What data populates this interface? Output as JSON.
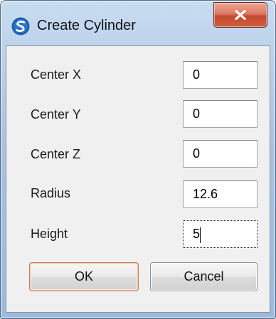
{
  "window": {
    "title": "Create Cylinder",
    "app_icon": "app-logo-icon",
    "close_icon": "close-icon",
    "close_symbol": "✕"
  },
  "fields": [
    {
      "label": "Center X",
      "value": "0"
    },
    {
      "label": "Center Y",
      "value": "0"
    },
    {
      "label": "Center Z",
      "value": "0"
    },
    {
      "label": "Radius",
      "value": "12.6"
    },
    {
      "label": "Height",
      "value": "5"
    }
  ],
  "buttons": {
    "ok_label": "OK",
    "cancel_label": "Cancel"
  },
  "colors": {
    "frame_accent": "#bcd3ec",
    "close_button": "#c24a30",
    "default_button_border": "#c57d5b",
    "logo_blue": "#1f5ca8"
  }
}
